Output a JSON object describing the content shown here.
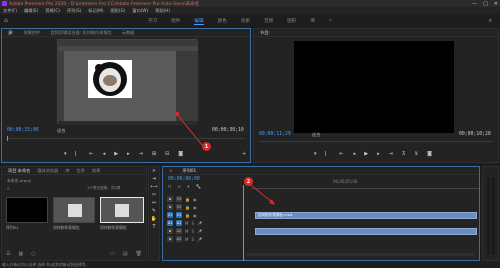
{
  "app": {
    "title": "Adobe Premiere Pro 2020 - D:\\premiere Pro CC\\Adobe Premiere Pro Auto-Save\\未命名",
    "window_controls": [
      "—",
      "□",
      "✕"
    ]
  },
  "menu": [
    "文件(F)",
    "编辑(E)",
    "剪辑(C)",
    "序列(S)",
    "标记(M)",
    "图形(G)",
    "窗口(W)",
    "帮助(H)"
  ],
  "workspace": {
    "home": "⌂",
    "tabs": [
      "学习",
      "组件",
      "编辑",
      "颜色",
      "效果",
      "音频",
      "图形",
      "库"
    ],
    "active_index": 2,
    "overflow": "»"
  },
  "source_monitor": {
    "tabs": [
      "源:",
      "效果控件",
      "音频剪辑混合器: 如何制作表情包",
      "元数据"
    ],
    "timecode_left": "00;00;15;06",
    "fit": "适合",
    "timecode_right": "00;00;30;10",
    "badge": "1"
  },
  "program_monitor": {
    "tab": "节目:",
    "timecode_left": "00;00;11;29",
    "fit": "适合",
    "timecode_right": "00;00;10;20"
  },
  "project": {
    "tabs": [
      "项目:未命名",
      "媒体浏览器",
      "库",
      "信息",
      "效果"
    ],
    "project_file": "未命名.prproj",
    "item_count": "1个项已选择，共3项",
    "thumbs": [
      {
        "label": "序列01"
      },
      {
        "label": "如何制作表情包"
      },
      {
        "label": "如何制作表情包"
      }
    ]
  },
  "timeline": {
    "tab": "序列01",
    "timecode": "00;00;00;00",
    "ruler_label": "00;00;05;00",
    "badge": "2",
    "video_tracks": [
      "V3",
      "V2",
      "V1"
    ],
    "audio_tracks": [
      "A1",
      "A2",
      "A3"
    ],
    "clip_label": "如何制作表情包.mp4"
  },
  "status_text": "输入并拖动到以选择 选择 和/或其他拖动到选择等。",
  "colors": {
    "accent": "#4b9cff",
    "badge": "#d82a2a",
    "clip": "#6a8cbf"
  }
}
